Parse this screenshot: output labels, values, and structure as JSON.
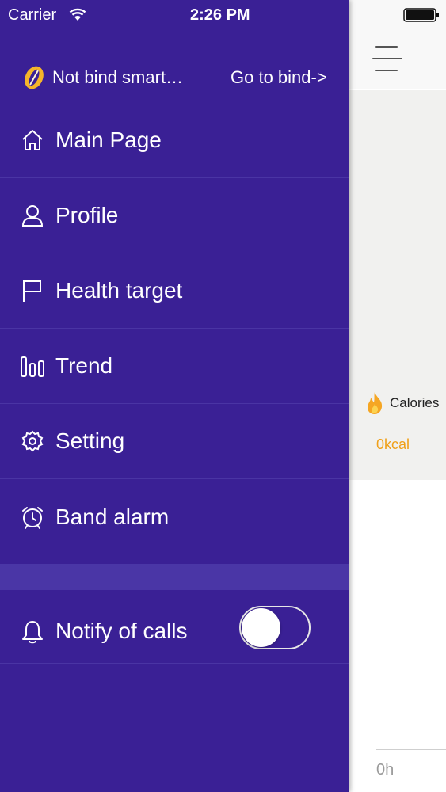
{
  "status_bar": {
    "carrier": "Carrier",
    "time": "2:26 PM"
  },
  "drawer": {
    "bind_status": "Not bind smart…",
    "bind_link": "Go to bind->",
    "menu": [
      {
        "label": "Main Page",
        "icon": "home-icon"
      },
      {
        "label": "Profile",
        "icon": "person-icon"
      },
      {
        "label": "Health target",
        "icon": "flag-icon"
      },
      {
        "label": "Trend",
        "icon": "bar-chart-icon"
      },
      {
        "label": "Setting",
        "icon": "gear-icon"
      },
      {
        "label": "Band alarm",
        "icon": "alarm-clock-icon"
      }
    ],
    "notify_calls": {
      "label": "Notify of calls",
      "icon": "bell-icon",
      "enabled": false
    }
  },
  "main": {
    "calories_label": "Calories",
    "calories_value": "0kcal",
    "axis_start_label": "0h"
  },
  "colors": {
    "drawer_bg": "#3a2095",
    "accent_orange": "#f0a019"
  }
}
